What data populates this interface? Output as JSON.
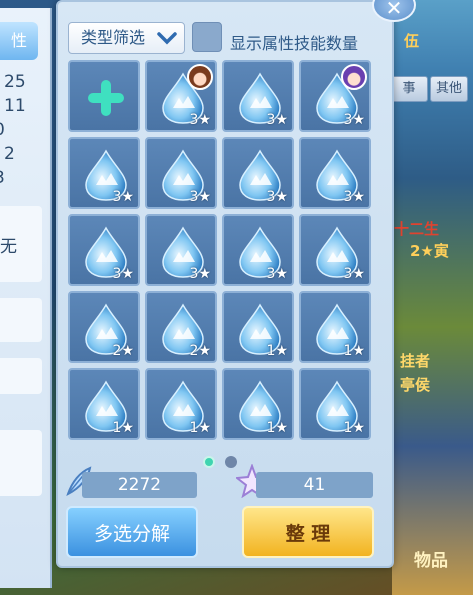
{
  "left_panel": {
    "tab_label": "性",
    "numbers": [
      "25",
      "11",
      "0",
      "2",
      "3"
    ],
    "value_label": "无"
  },
  "filter": {
    "label": "类型筛选"
  },
  "toggle": {
    "label": "显示属性技能数量",
    "checked": false
  },
  "grid": {
    "cells": [
      {
        "kind": "add"
      },
      {
        "stars": "3★",
        "avatar": "girl"
      },
      {
        "stars": "3★"
      },
      {
        "stars": "3★",
        "avatar": "purple"
      },
      {
        "stars": "3★"
      },
      {
        "stars": "3★"
      },
      {
        "stars": "3★"
      },
      {
        "stars": "3★"
      },
      {
        "stars": "3★"
      },
      {
        "stars": "3★"
      },
      {
        "stars": "3★"
      },
      {
        "stars": "3★"
      },
      {
        "stars": "2★"
      },
      {
        "stars": "2★"
      },
      {
        "stars": "1★"
      },
      {
        "stars": "1★"
      },
      {
        "stars": "1★"
      },
      {
        "stars": "1★"
      },
      {
        "stars": "1★"
      },
      {
        "stars": "1★"
      }
    ]
  },
  "pagination": {
    "pages": 2,
    "active": 1
  },
  "stats": {
    "feather_count": "2272",
    "crystal_count": "41"
  },
  "buttons": {
    "multi_decompose": "多选分解",
    "sort": "整 理"
  },
  "background": {
    "tab1": "事",
    "tab2": "其他",
    "text1": "伍",
    "text2": "十二生",
    "text3": "2★寅",
    "text4": "挂者",
    "text5": "亭侯",
    "text6": "物品"
  },
  "colors": {
    "accent": "#3b91e0",
    "gold": "#f2b320",
    "panel": "#c6dbee"
  }
}
